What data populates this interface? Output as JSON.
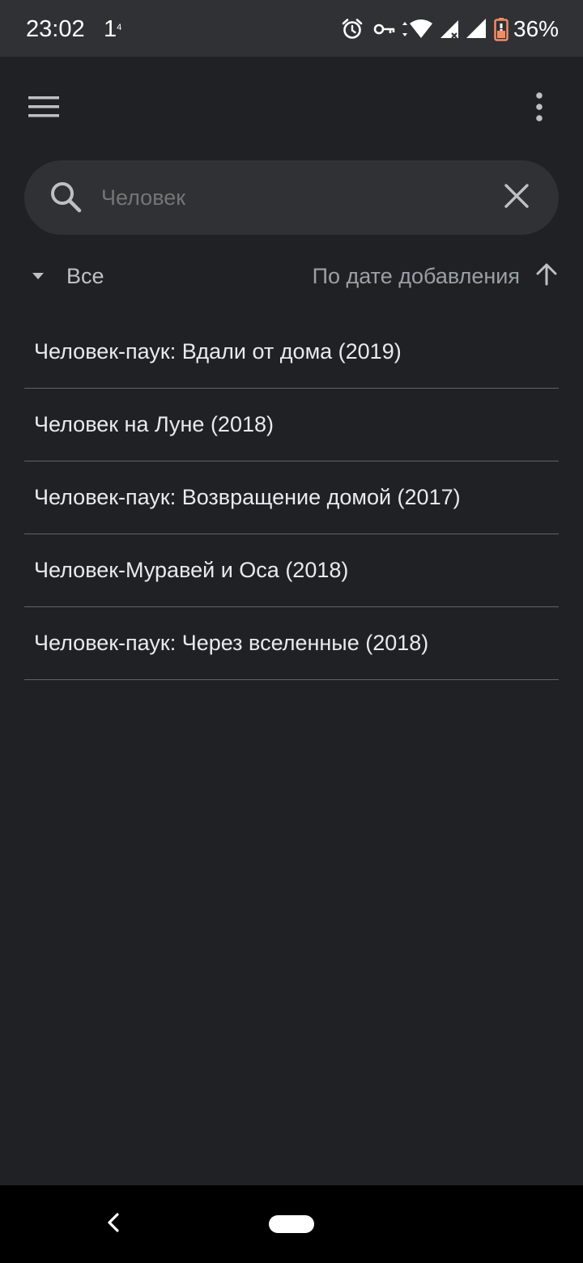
{
  "status_bar": {
    "time": "23:02",
    "notification_digit": "1",
    "notification_sup": "4",
    "battery_percent": "36%",
    "icons": [
      "alarm-icon",
      "vpn-key-icon",
      "wifi-icon",
      "signal-icon",
      "signal-icon",
      "battery-icon"
    ]
  },
  "app_bar": {
    "icons": [
      "menu-icon",
      "more-vert-icon"
    ]
  },
  "search": {
    "value": "",
    "placeholder": "Человек"
  },
  "filter": {
    "label": "Все"
  },
  "sort": {
    "label": "По дате добавления",
    "direction": "ascending"
  },
  "results": [
    {
      "title": "Человек-паук: Вдали от дома (2019)"
    },
    {
      "title": "Человек на Луне (2018)"
    },
    {
      "title": "Человек-паук: Возвращение домой (2017)"
    },
    {
      "title": "Человек-Муравей и Оса (2018)"
    },
    {
      "title": "Человек-паук: Через вселенные (2018)"
    }
  ],
  "colors": {
    "background": "#202124",
    "surface": "#303134",
    "text_primary": "#e8eaed",
    "text_secondary": "#9aa0a6",
    "battery_low": "#f28b64"
  }
}
